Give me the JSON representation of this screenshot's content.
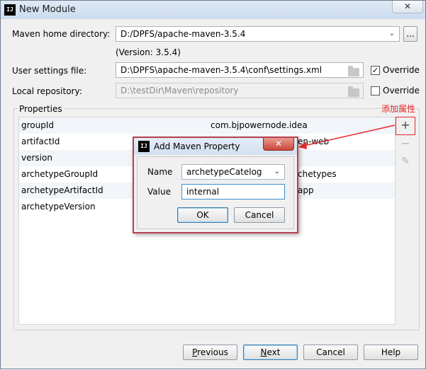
{
  "window": {
    "title": "New Module",
    "app_icon": "IJ",
    "close_icon": "close-icon"
  },
  "form": {
    "maven_home_label": "Maven home directory:",
    "maven_home_value": "D:/DPFS/apache-maven-3.5.4",
    "version_text": "(Version: 3.5.4)",
    "browse_label": "...",
    "user_settings_label": "User settings file:",
    "user_settings_value": "D:\\DPFS\\apache-maven-3.5.4\\conf\\settings.xml",
    "override_label": "Override",
    "override_checked_mark": "✓",
    "local_repo_label": "Local repository:",
    "local_repo_value": "D:\\testDir\\Maven\\repository",
    "override2_label": "Override"
  },
  "properties": {
    "group_label": "Properties",
    "rows": [
      {
        "key": "groupId",
        "value": "com.bjpowernode.idea"
      },
      {
        "key": "artifactId",
        "value": "en-web"
      },
      {
        "key": "version",
        "value": ""
      },
      {
        "key": "archetypeGroupId",
        "value": "chetypes"
      },
      {
        "key": "archetypeArtifactId",
        "value": "app"
      },
      {
        "key": "archetypeVersion",
        "value": ""
      }
    ],
    "add_icon_glyph": "+",
    "remove_icon_glyph": "−",
    "edit_icon_glyph": "✎"
  },
  "annotation": {
    "text": "添加属性",
    "color": "#e5282b"
  },
  "dialog": {
    "title": "Add Maven Property",
    "icon": "IJ",
    "close_glyph": "✕",
    "name_label": "Name",
    "name_value": "archetypeCatelog",
    "value_label": "Value",
    "value_value": "internal",
    "ok_label": "OK",
    "cancel_label": "Cancel"
  },
  "footer": {
    "previous_label": "Previous",
    "next_label": "Next",
    "cancel_label": "Cancel",
    "help_label": "Help"
  }
}
